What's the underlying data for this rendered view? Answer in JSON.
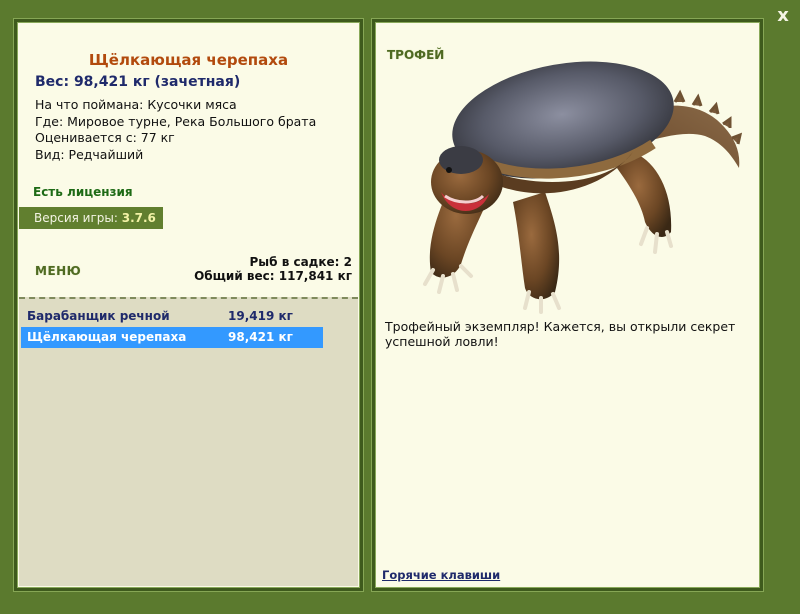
{
  "fish": {
    "name": "Щёлкающая черепаха",
    "weight_line": "Вес: 98,421 кг (зачетная)",
    "caught_on": "На что поймана: Кусочки мяса",
    "location": "Где: Мировое турне, Река Большого брата",
    "rated_from": "Оценивается с: 77 кг",
    "kind": "Вид: Редчайший"
  },
  "license": "Есть лицензия",
  "version": {
    "label": "Версия игры:",
    "value": "3.7.6"
  },
  "menu_label": "МЕНЮ",
  "keepnet": {
    "count_text": "Рыб в садке: 2",
    "total_text": "Общий вес: 117,841 кг",
    "items": [
      {
        "name": "Барабанщик речной",
        "weight": "19,419 кг",
        "selected": false
      },
      {
        "name": "Щёлкающая черепаха",
        "weight": "98,421 кг",
        "selected": true
      }
    ]
  },
  "trophy": {
    "label": "ТРОФЕЙ",
    "description": "Трофейный экземпляр! Кажется, вы открыли секрет успешной ловли!"
  },
  "hotkeys_label": "Горячие клавиши",
  "close_glyph": "x",
  "colors": {
    "background": "#5b7a2e",
    "panel": "#fbfbe7",
    "title": "#b24a0d",
    "selected_row": "#3399ff"
  }
}
